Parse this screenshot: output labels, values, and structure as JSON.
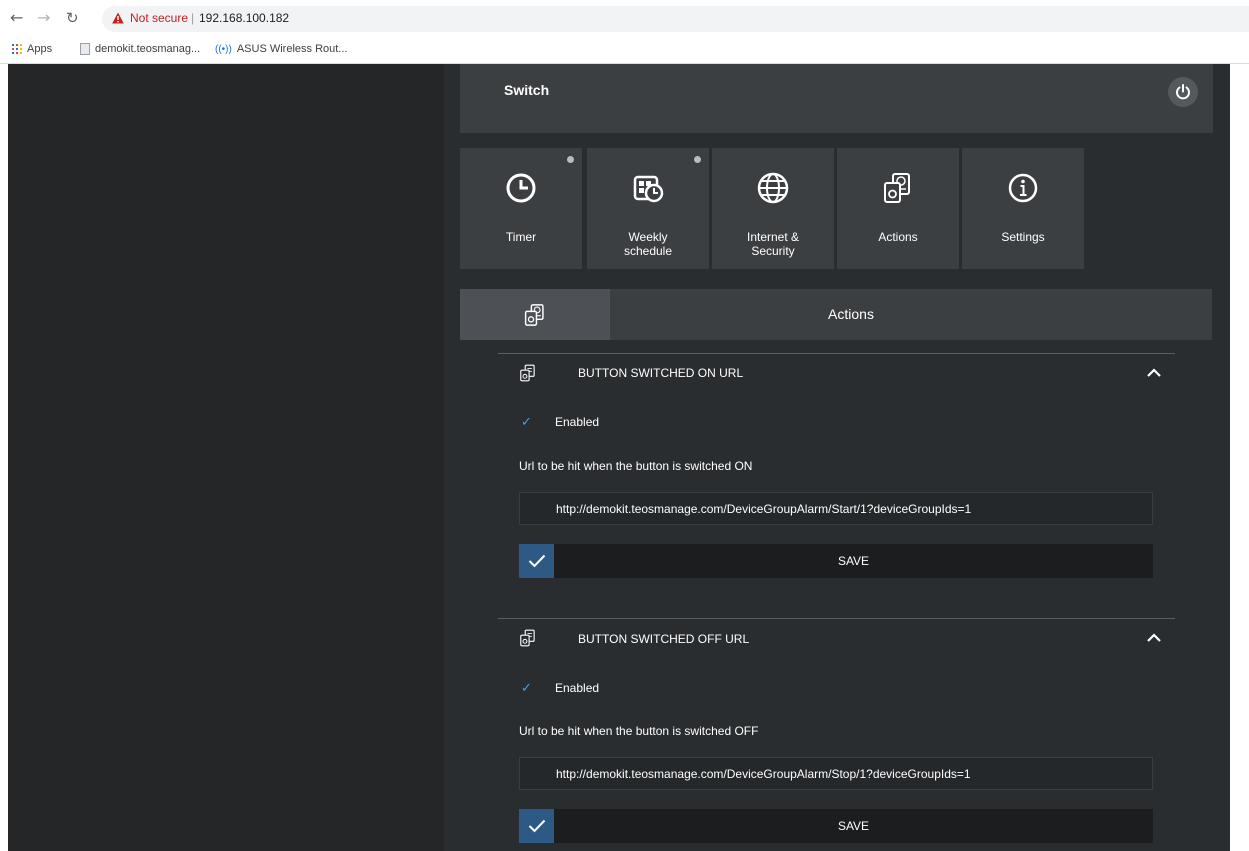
{
  "browser": {
    "security_label": "Not secure",
    "url": "192.168.100.182",
    "bookmarks": [
      "Apps",
      "demokit.teosmanag...",
      "ASUS Wireless Rout..."
    ]
  },
  "header": {
    "title": "Switch"
  },
  "tiles": [
    {
      "label": "Timer",
      "icon": "clock-icon",
      "indicator": true
    },
    {
      "label": "Weekly\nschedule",
      "icon": "weekly-schedule-icon",
      "indicator": true
    },
    {
      "label": "Internet &\nSecurity",
      "icon": "globe-icon",
      "indicator": false
    },
    {
      "label": "Actions",
      "icon": "actions-icon",
      "indicator": false
    },
    {
      "label": "Settings",
      "icon": "info-icon",
      "indicator": false
    }
  ],
  "actions_bar": {
    "title": "Actions"
  },
  "sections": [
    {
      "title": "BUTTON SWITCHED ON URL",
      "enabled_label": "Enabled",
      "enabled": true,
      "description": "Url to be hit when the button is switched ON",
      "url_value": "http://demokit.teosmanage.com/DeviceGroupAlarm/Start/1?deviceGroupIds=1",
      "save_label": "SAVE"
    },
    {
      "title": "BUTTON SWITCHED OFF URL",
      "enabled_label": "Enabled",
      "enabled": true,
      "description": "Url to be hit when the button is switched OFF",
      "url_value": "http://demokit.teosmanage.com/DeviceGroupAlarm/Stop/1?deviceGroupIds=1",
      "save_label": "SAVE"
    }
  ],
  "colors": {
    "accent": "#2c5a84",
    "check": "#4aa0e0",
    "tile_bg": "#3c3f42"
  }
}
